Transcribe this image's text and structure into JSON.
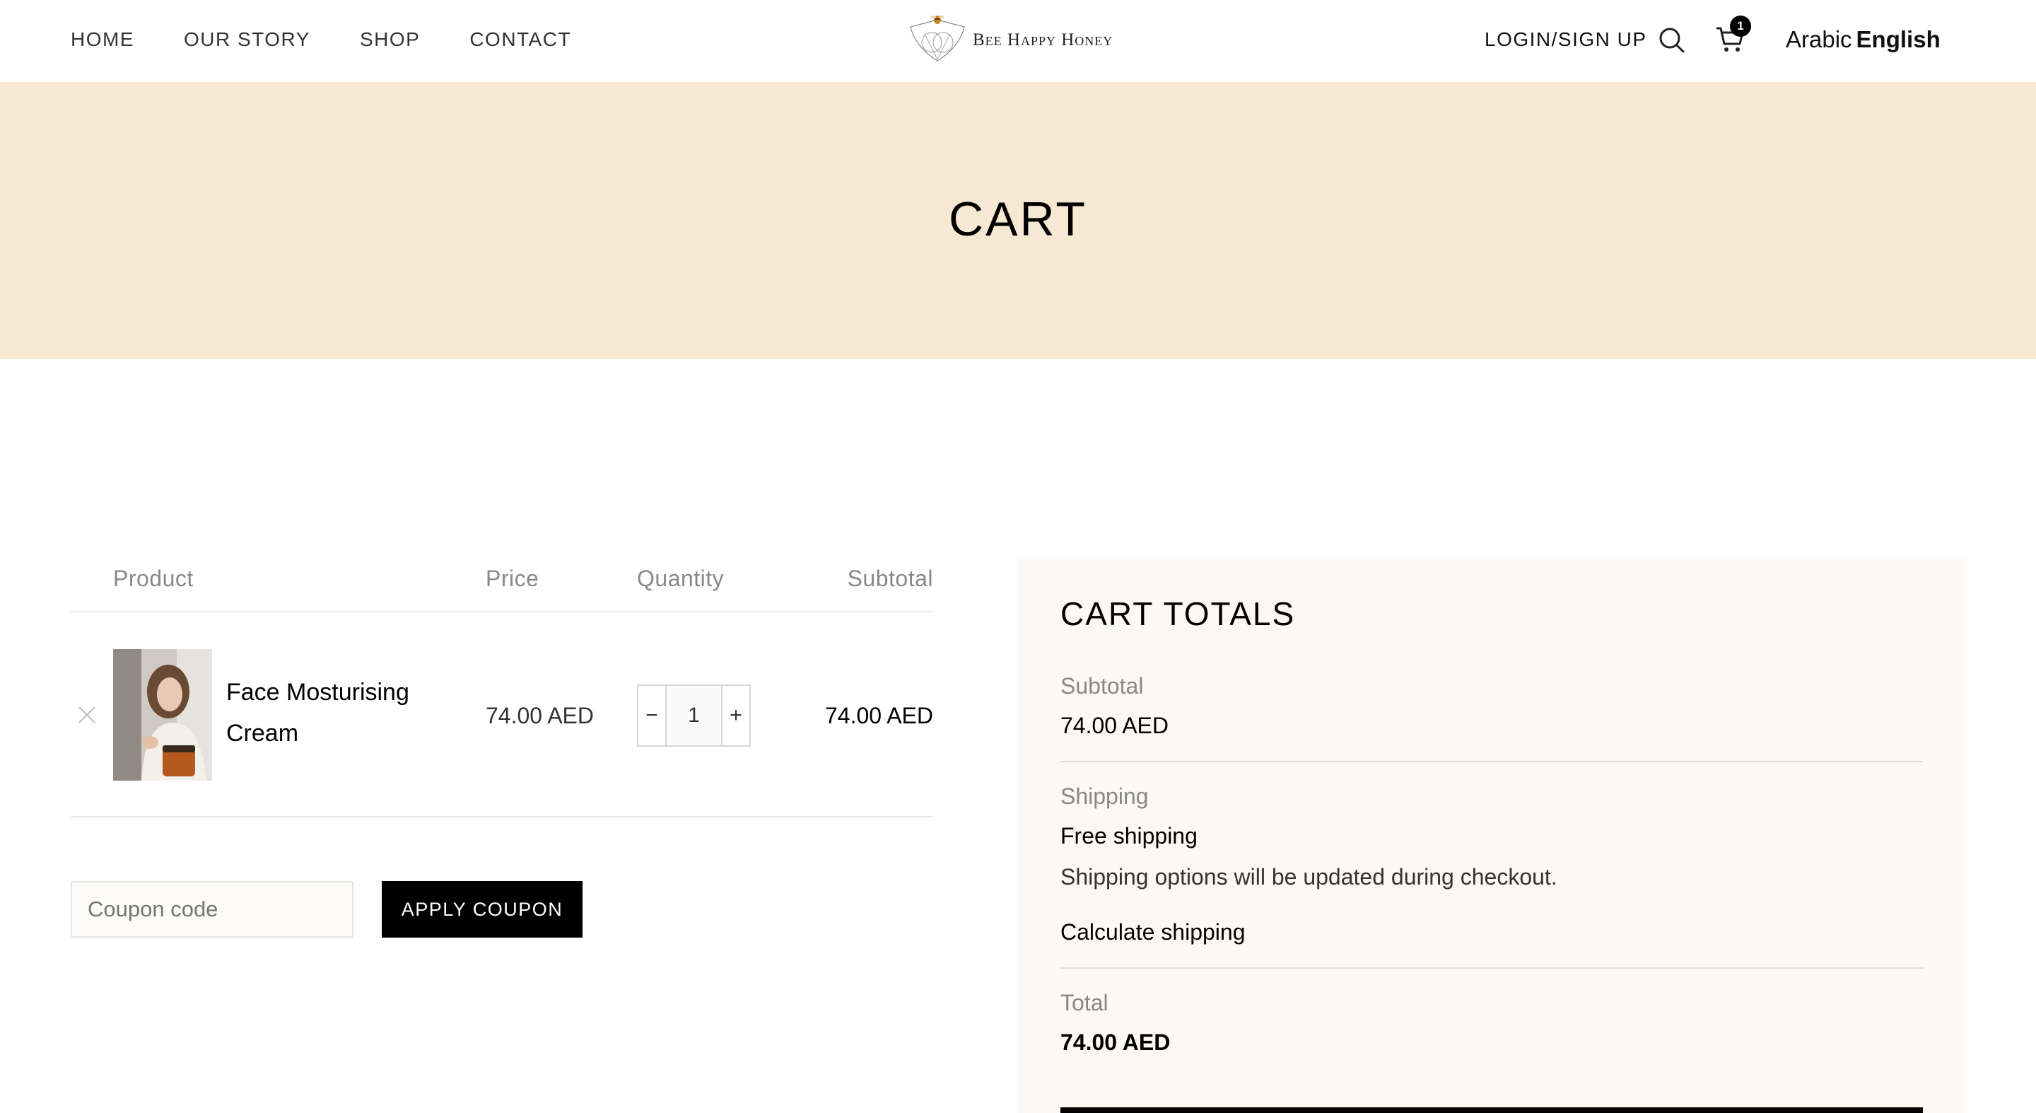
{
  "header": {
    "nav": [
      "HOME",
      "OUR STORY",
      "SHOP",
      "CONTACT"
    ],
    "logo_text": "Bee Happy Honey",
    "login_label": "LOGIN/SIGN UP",
    "cart_count": "1",
    "lang_arabic": "Arabic",
    "lang_english": "English"
  },
  "banner": {
    "title": "CART"
  },
  "table": {
    "headers": {
      "product": "Product",
      "price": "Price",
      "quantity": "Quantity",
      "subtotal": "Subtotal"
    },
    "items": [
      {
        "name": "Face Mosturising Cream",
        "price": "74.00 AED",
        "quantity": "1",
        "subtotal": "74.00 AED"
      }
    ]
  },
  "coupon": {
    "placeholder": "Coupon code",
    "button_label": "APPLY COUPON"
  },
  "totals": {
    "title": "CART TOTALS",
    "subtotal_label": "Subtotal",
    "subtotal_value": "74.00 AED",
    "shipping_label": "Shipping",
    "shipping_value": "Free shipping",
    "shipping_note": "Shipping options will be updated during checkout.",
    "calc_shipping": "Calculate shipping",
    "total_label": "Total",
    "total_value": "74.00 AED"
  },
  "colors": {
    "banner_bg": "#f7e8d4",
    "totals_bg": "#fcf9f4",
    "button_bg": "#000000"
  }
}
